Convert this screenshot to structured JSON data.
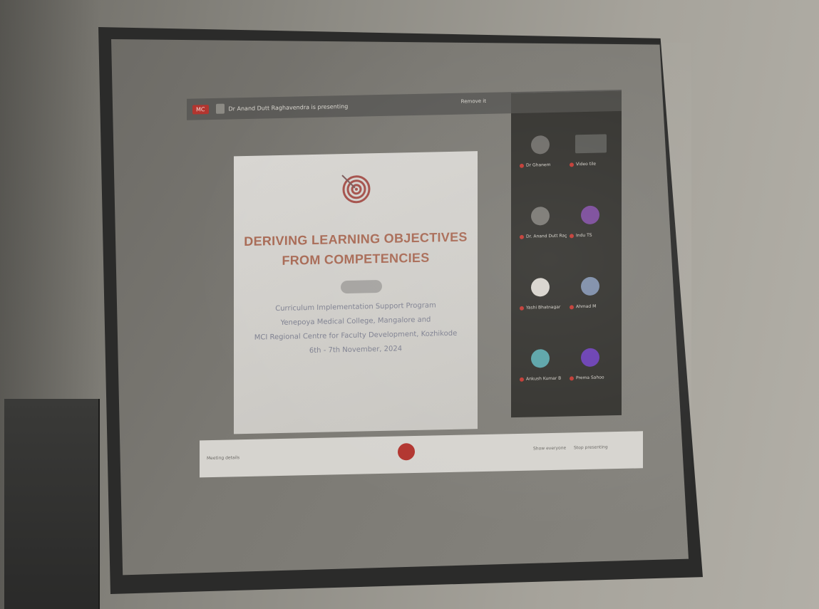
{
  "meeting": {
    "badge": "MC",
    "presenter_text": "Dr Anand Dutt Raghavendra is presenting",
    "topright_text": "Remove it"
  },
  "slide": {
    "title_line1": "DERIVING LEARNING OBJECTIVES",
    "title_line2": "FROM COMPETENCIES",
    "line1": "Curriculum Implementation Support Program",
    "line2": "Yenepoya Medical College, Mangalore and",
    "line3": "MCI Regional Centre for Faculty Development, Kozhikode",
    "line4": "6th - 7th November, 2024"
  },
  "participants": [
    {
      "name": "Dr Ghanem",
      "avatar_color": "#6f6d69"
    },
    {
      "name": "Video tile",
      "avatar_color": "#5a5a56"
    },
    {
      "name": "Dr. Anand Dutt Raghu",
      "avatar_color": "#7a7873"
    },
    {
      "name": "Indu TS",
      "avatar_color": "#7a4a9a"
    },
    {
      "name": "Yashi Bhatnagar",
      "avatar_color": "#d7d3cc"
    },
    {
      "name": "Ahmad M",
      "avatar_color": "#7d8da8"
    },
    {
      "name": "Ankush Kumar B",
      "avatar_color": "#5aa3a8"
    },
    {
      "name": "Prema Sahoo",
      "avatar_color": "#6a3fb2"
    }
  ],
  "bottombar": {
    "left_text": "Meeting details",
    "right_text_1": "Show everyone",
    "right_text_2": "Stop presenting"
  },
  "colors": {
    "accent_red": "#b2352f",
    "title_color": "#a86a55"
  }
}
